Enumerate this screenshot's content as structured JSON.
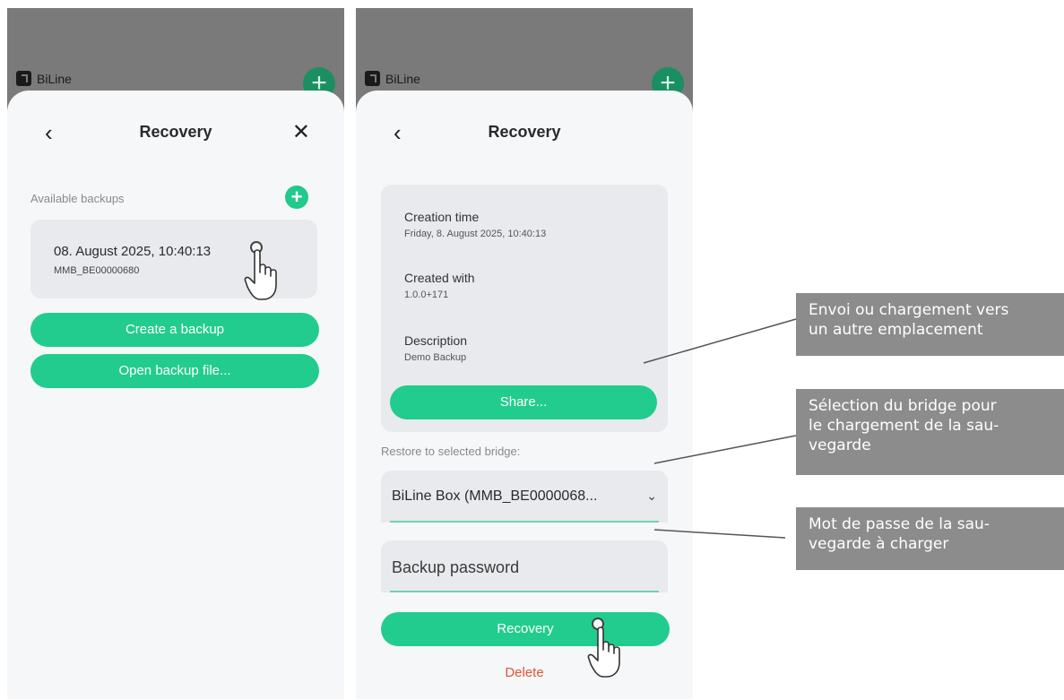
{
  "left_screen": {
    "brand": "BiLine",
    "title": "Recovery",
    "section_label": "Available backups",
    "backup_item": {
      "title": "08. August 2025, 10:40:13",
      "bridge_id": "MMB_BE00000680"
    },
    "create_button": "Create a backup",
    "open_button": "Open backup file..."
  },
  "right_screen": {
    "brand": "BiLine",
    "title": "Recovery",
    "creation_time_label": "Creation time",
    "creation_time_value": "Friday, 8. August 2025, 10:40:13",
    "created_with_label": "Created with",
    "created_with_value": "1.0.0+171",
    "description_label": "Description",
    "description_value": "Demo Backup",
    "share_button": "Share...",
    "restore_label": "Restore to selected bridge:",
    "bridge_select_value": "BiLine Box (MMB_BE0000068...",
    "password_placeholder": "Backup password",
    "recovery_button": "Recovery",
    "delete_link": "Delete"
  },
  "annotations": [
    "Envoi ou chargement vers\nun autre emplacement",
    "Sélection du bridge pour\nle chargement de la sau-\nvegarde",
    "Mot de passe de la sau-\nvegarde à charger"
  ],
  "colors": {
    "accent_green": "#22cc8e",
    "delete_red": "#e0533a",
    "overlay_gray": "#7a7a7a",
    "callout_gray": "#8c8c8c"
  },
  "icons": {
    "back": "chevron-left-icon",
    "close": "close-icon",
    "add": "plus-circle-icon",
    "dropdown": "chevron-down-icon",
    "pointer": "tap-hand-icon"
  }
}
